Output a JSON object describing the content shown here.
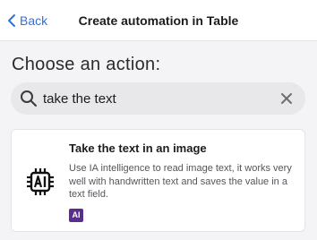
{
  "header": {
    "back_label": "Back",
    "title": "Create automation in Table"
  },
  "section": {
    "heading": "Choose an action:"
  },
  "search": {
    "value": "take the text",
    "icon": "search-icon",
    "clear_icon": "close-icon"
  },
  "results": [
    {
      "title": "Take the text in an image",
      "description": "Use IA intelligence to read image text, it works very well with handwritten text and saves the value in a text field.",
      "icon": "ai-chip-icon",
      "badge": "AI",
      "badge_color": "#5c2d91"
    }
  ],
  "colors": {
    "accent": "#2f6fe4",
    "background": "#f4f4f6",
    "search_bg": "#e8e8eb"
  }
}
